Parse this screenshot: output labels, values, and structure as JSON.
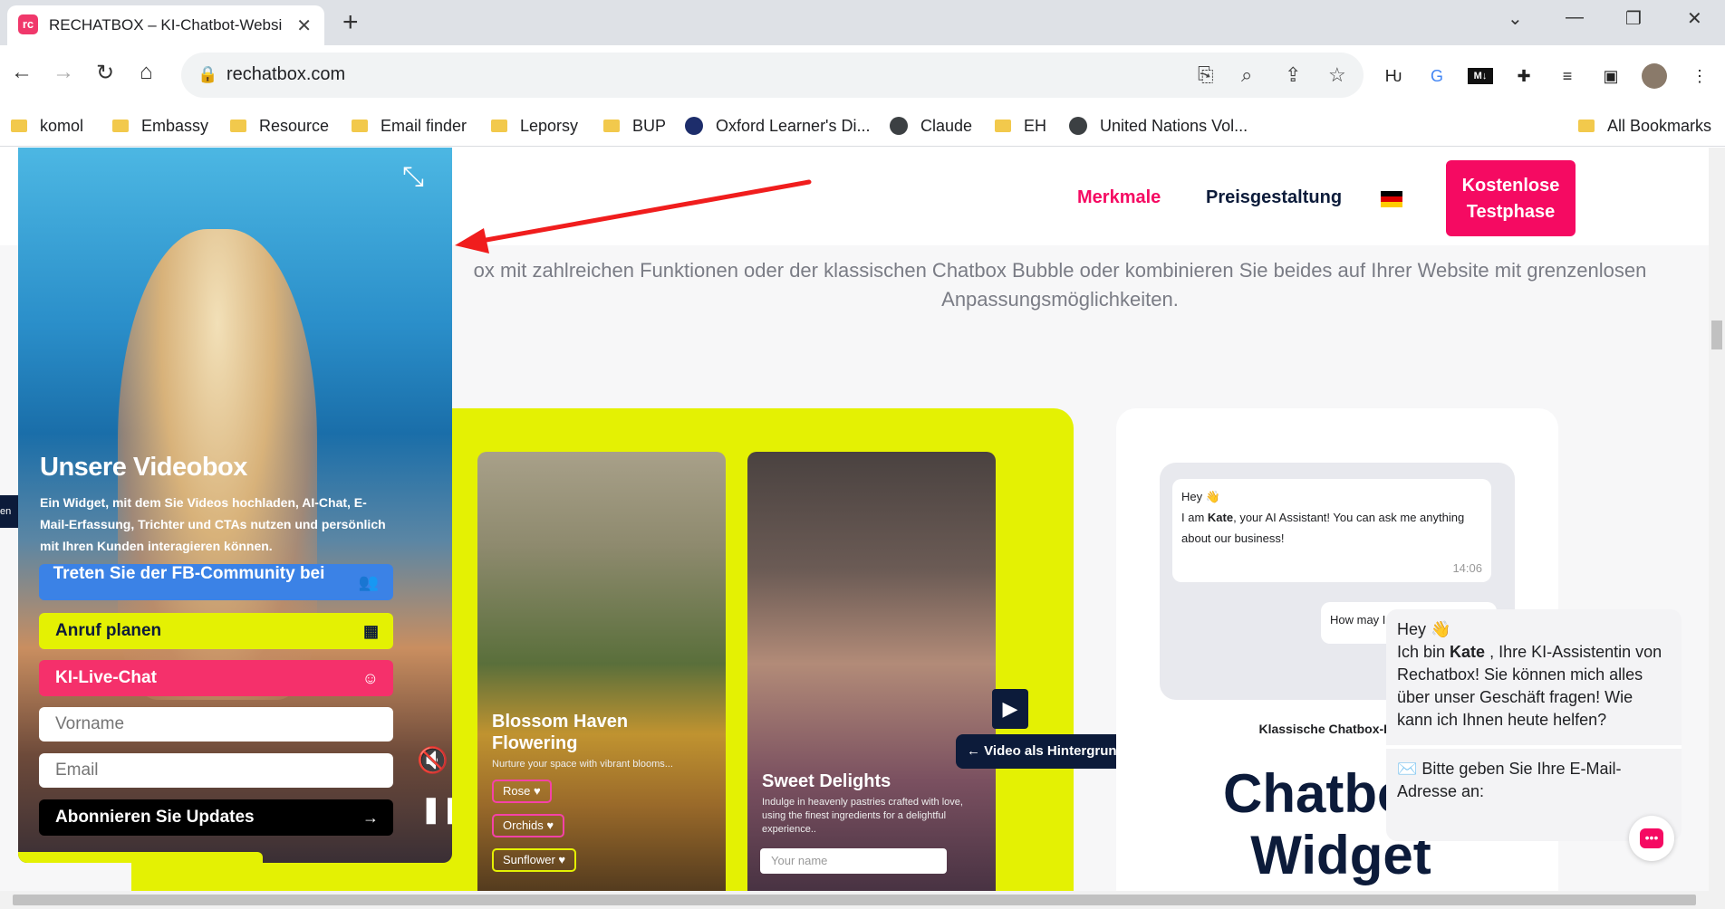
{
  "browser": {
    "tab_title": "RECHATBOX – KI-Chatbot-Websi",
    "tab_close": "✕",
    "new_tab": "+",
    "url": "rechatbox.com",
    "window": {
      "minimize": "—",
      "restore": "❐",
      "close": "✕",
      "tabsearch": "⌄"
    },
    "bookmarks": [
      "komol",
      "Embassy",
      "Resource",
      "Email finder",
      "Leporsy",
      "BUP",
      "Oxford Learner's Di...",
      "Claude",
      "EH",
      "United Nations Vol...",
      "All Bookmarks"
    ]
  },
  "site": {
    "nav": {
      "features": "Merkmale",
      "pricing": "Preisgestaltung",
      "cta": "Kostenlose Testphase"
    },
    "accent": "#f50a62",
    "intro": "ox mit zahlreichen Funktionen oder der klassischen Chatbox Bubble oder kombinieren Sie beides auf Ihrer Website mit grenzenlosen Anpassungsmöglichkeiten.",
    "cards": [
      {
        "title": "Blossom Haven Flowering",
        "desc": "Nurture your space with vibrant blooms...",
        "tags": [
          "Rose ♥",
          "Orchids ♥",
          "Sunflower ♥"
        ]
      },
      {
        "title": "Sweet Delights",
        "desc": "Indulge in heavenly pastries crafted with love, using the finest ingredients for a delightful experience..",
        "input_placeholder": "Your name"
      }
    ],
    "bg_tip": "← Video als Hintergrund hochladen",
    "chat_preview": {
      "greeting": "Hey 👋",
      "intro_pre": "I am ",
      "intro_name": "Kate",
      "intro_post": ", your AI Assistant! You can ask me anything about our business!",
      "time": "14:06",
      "question": "How may I help you today?"
    },
    "chatbox_label": "Klassische Chatbox-Blase",
    "chatbox_title": "Chatbox-Widget",
    "bubble": {
      "greeting": "Hey 👋",
      "text_pre": "Ich bin ",
      "name": "Kate",
      "text_post": " , Ihre KI-Assistentin von Rechatbox! Sie können mich alles über unser Geschäft fragen! Wie kann ich Ihnen heute helfen?",
      "email_prompt": "✉️ Bitte geben Sie Ihre E-Mail-Adresse an:"
    },
    "left_edge_text": "en S"
  },
  "widget": {
    "title": "Unsere Videobox",
    "description": "Ein Widget, mit dem Sie Videos hochladen, AI-Chat, E-Mail-Erfassung, Trichter und CTAs nutzen und persönlich mit Ihren Kunden interagieren können.",
    "buttons": {
      "fb": "Treten Sie der FB-Community bei",
      "call": "Anruf planen",
      "chat": "KI-Live-Chat",
      "subscribe": "Abonnieren Sie Updates"
    },
    "inputs": {
      "first_name": "Vorname",
      "email": "Email"
    },
    "colors": {
      "fb": "#3b82e6",
      "call": "#e4f103",
      "chat": "#f5306b"
    }
  }
}
